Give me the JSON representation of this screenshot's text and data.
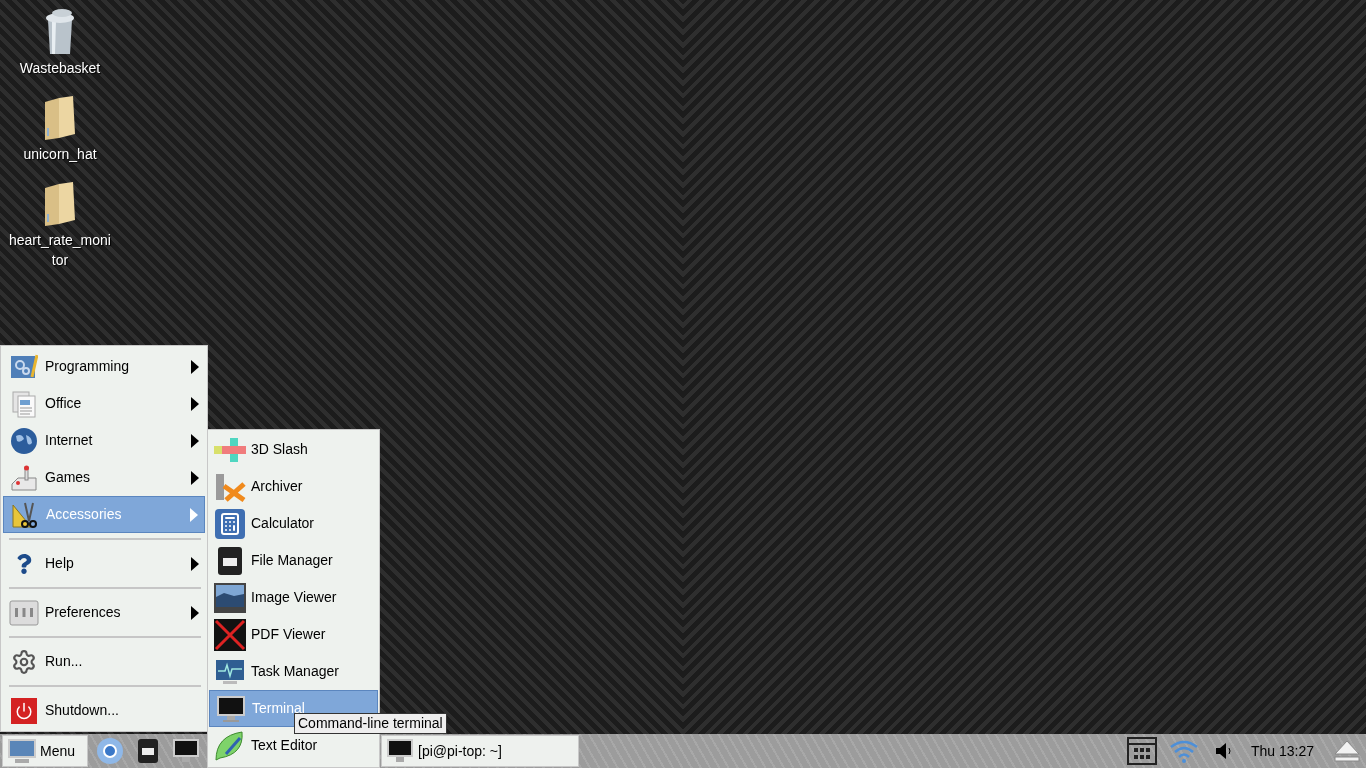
{
  "desktop_icons": [
    {
      "label": "Wastebasket"
    },
    {
      "label": "unicorn_hat"
    },
    {
      "label": "heart_rate_moni tor"
    }
  ],
  "menu": {
    "items": [
      {
        "label": "Programming",
        "submenu": true,
        "selected": false,
        "separator_before": false
      },
      {
        "label": "Office",
        "submenu": true,
        "selected": false,
        "separator_before": false
      },
      {
        "label": "Internet",
        "submenu": true,
        "selected": false,
        "separator_before": false
      },
      {
        "label": "Games",
        "submenu": true,
        "selected": false,
        "separator_before": false
      },
      {
        "label": "Accessories",
        "submenu": true,
        "selected": true,
        "separator_before": false
      },
      {
        "label": "Help",
        "submenu": true,
        "selected": false,
        "separator_before": true
      },
      {
        "label": "Preferences",
        "submenu": true,
        "selected": false,
        "separator_before": true
      },
      {
        "label": "Run...",
        "submenu": false,
        "selected": false,
        "separator_before": true
      },
      {
        "label": "Shutdown...",
        "submenu": false,
        "selected": false,
        "separator_before": true
      }
    ]
  },
  "submenu": {
    "items": [
      {
        "label": "3D Slash",
        "selected": false
      },
      {
        "label": "Archiver",
        "selected": false
      },
      {
        "label": "Calculator",
        "selected": false
      },
      {
        "label": "File Manager",
        "selected": false
      },
      {
        "label": "Image Viewer",
        "selected": false
      },
      {
        "label": "PDF Viewer",
        "selected": false
      },
      {
        "label": "Task Manager",
        "selected": false
      },
      {
        "label": "Terminal",
        "selected": true
      },
      {
        "label": "Text Editor",
        "selected": false
      }
    ]
  },
  "tooltip": {
    "text": "Command-line terminal"
  },
  "taskbar": {
    "menu_button": "Menu",
    "windows": [
      {
        "label": "[pi@pi-top: ~]"
      }
    ],
    "clock": "Thu 13:27"
  }
}
